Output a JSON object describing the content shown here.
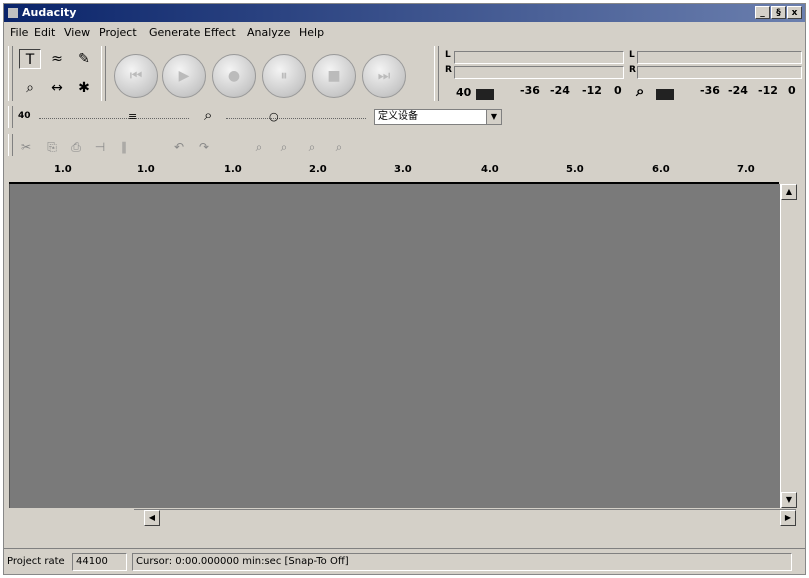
{
  "window": {
    "title": "Audacity",
    "min": "_",
    "max": "§",
    "close": "x"
  },
  "menu": [
    "File",
    "Edit",
    "View",
    "Project",
    "Generate",
    "Effect",
    "Analyze",
    "Help"
  ],
  "tools": {
    "select": "T",
    "envelope": "≈",
    "draw": "✎",
    "zoom": "⌕",
    "timeshift": "↔",
    "multi": "✱"
  },
  "transport": {
    "rewind": "⏮",
    "play": "▶",
    "record": "●",
    "pause": "⏸",
    "stop": "■",
    "end": "⏭"
  },
  "meters": {
    "output_labels": [
      "-36",
      "-24",
      "-12",
      "0"
    ],
    "input_labels": [
      "-36",
      "-24",
      "-12",
      "0"
    ],
    "output_prefix": "40",
    "l": "L",
    "r": "R"
  },
  "mixer": {
    "volume_icon": "40",
    "device": "定义设备"
  },
  "ruler": {
    "ticks": [
      "1.0",
      "1.0",
      "1.0",
      "2.0",
      "3.0",
      "4.0",
      "5.0",
      "6.0",
      "7.0"
    ]
  },
  "status": {
    "rate_label": "Project rate",
    "rate_value": "44100",
    "cursor_text": "Cursor: 0:00.000000 min:sec   [Snap-To Off]"
  }
}
